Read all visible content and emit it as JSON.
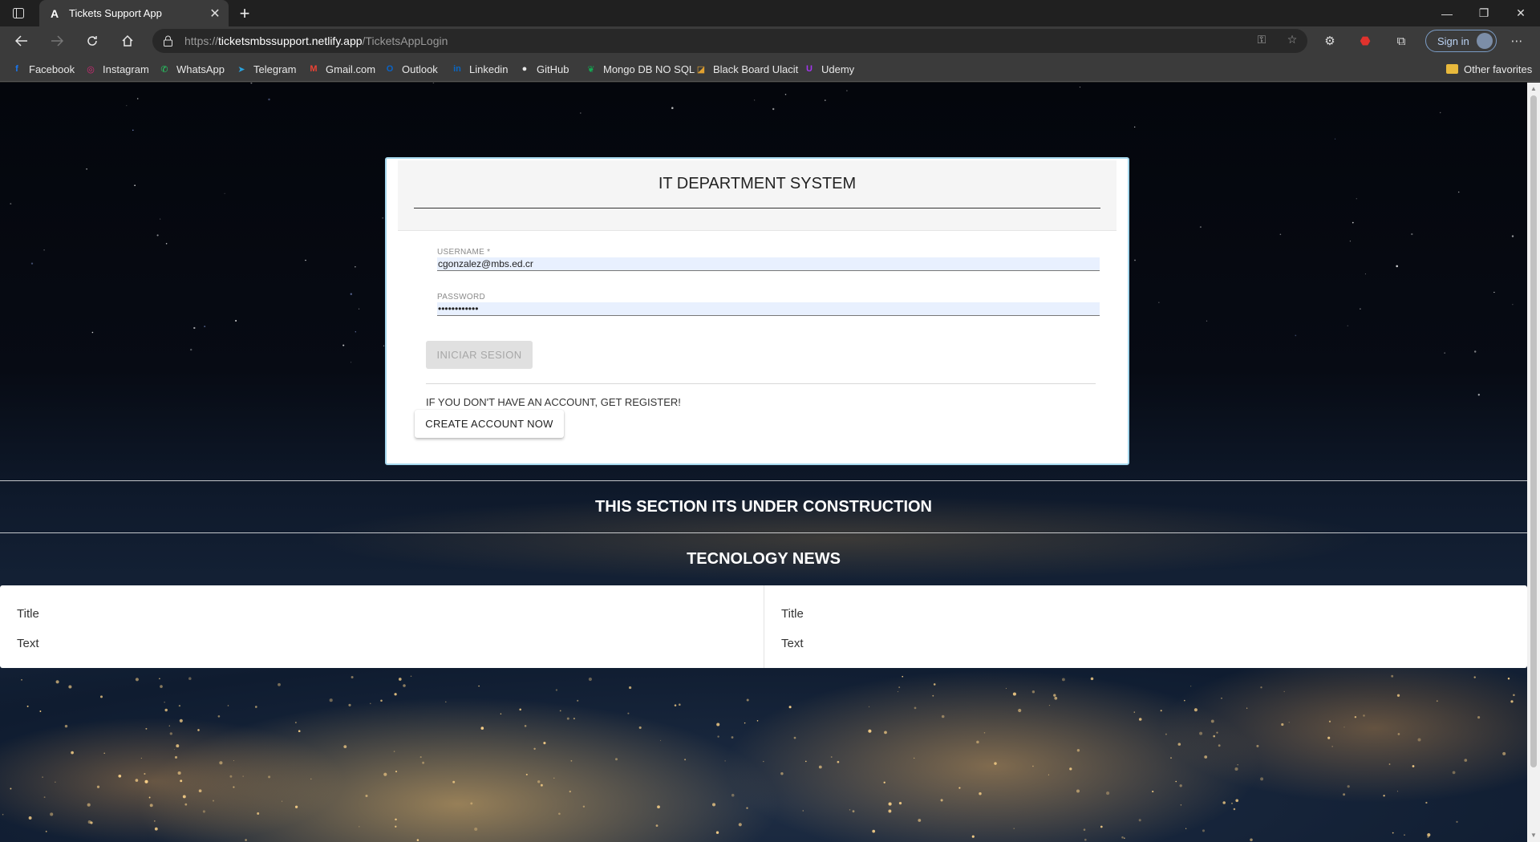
{
  "browser": {
    "tab_title": "Tickets Support App",
    "url_scheme": "https://",
    "url_host": "ticketsmbssupport.netlify.app",
    "url_path": "/TicketsAppLogin",
    "sign_in_label": "Sign in",
    "bookmarks": [
      {
        "label": "Facebook",
        "icon": "facebook-icon",
        "color": "#1877f2",
        "glyph": "f"
      },
      {
        "label": "Instagram",
        "icon": "instagram-icon",
        "color": "#d62976",
        "glyph": "◎"
      },
      {
        "label": "WhatsApp",
        "icon": "whatsapp-icon",
        "color": "#25d366",
        "glyph": "✆"
      },
      {
        "label": "Telegram",
        "icon": "telegram-icon",
        "color": "#2aa3df",
        "glyph": "➤"
      },
      {
        "label": "Gmail.com",
        "icon": "gmail-icon",
        "color": "#ea4335",
        "glyph": "M"
      },
      {
        "label": "Outlook",
        "icon": "outlook-icon",
        "color": "#0a64c8",
        "glyph": "O"
      },
      {
        "label": "Linkedin",
        "icon": "linkedin-icon",
        "color": "#0a66c2",
        "glyph": "in"
      },
      {
        "label": "GitHub",
        "icon": "github-icon",
        "color": "#e8e8e8",
        "glyph": "●"
      },
      {
        "label": "Mongo DB NO SQL",
        "icon": "mongodb-icon",
        "color": "#13aa52",
        "glyph": "❦"
      },
      {
        "label": "Black Board Ulacit",
        "icon": "blackboard-icon",
        "color": "#e0a030",
        "glyph": "◪"
      },
      {
        "label": "Udemy",
        "icon": "udemy-icon",
        "color": "#a435f0",
        "glyph": "U"
      }
    ],
    "other_favorites": "Other favorites"
  },
  "login": {
    "title": "IT DEPARTMENT SYSTEM",
    "username_label": "USERNAME *",
    "username_value": "cgonzalez@mbs.ed.cr",
    "password_label": "PASSWORD",
    "password_value": "••••••••••••",
    "login_button": "INICIAR SESION",
    "register_prompt": "IF YOU DON'T HAVE AN ACCOUNT, GET REGISTER!",
    "create_button": "CREATE ACCOUNT NOW"
  },
  "construction_banner": "THIS SECTION ITS UNDER CONSTRUCTION",
  "news": {
    "heading": "TECNOLOGY NEWS",
    "cards": [
      {
        "title": "Title",
        "text": "Text"
      },
      {
        "title": "Title",
        "text": "Text"
      }
    ]
  }
}
